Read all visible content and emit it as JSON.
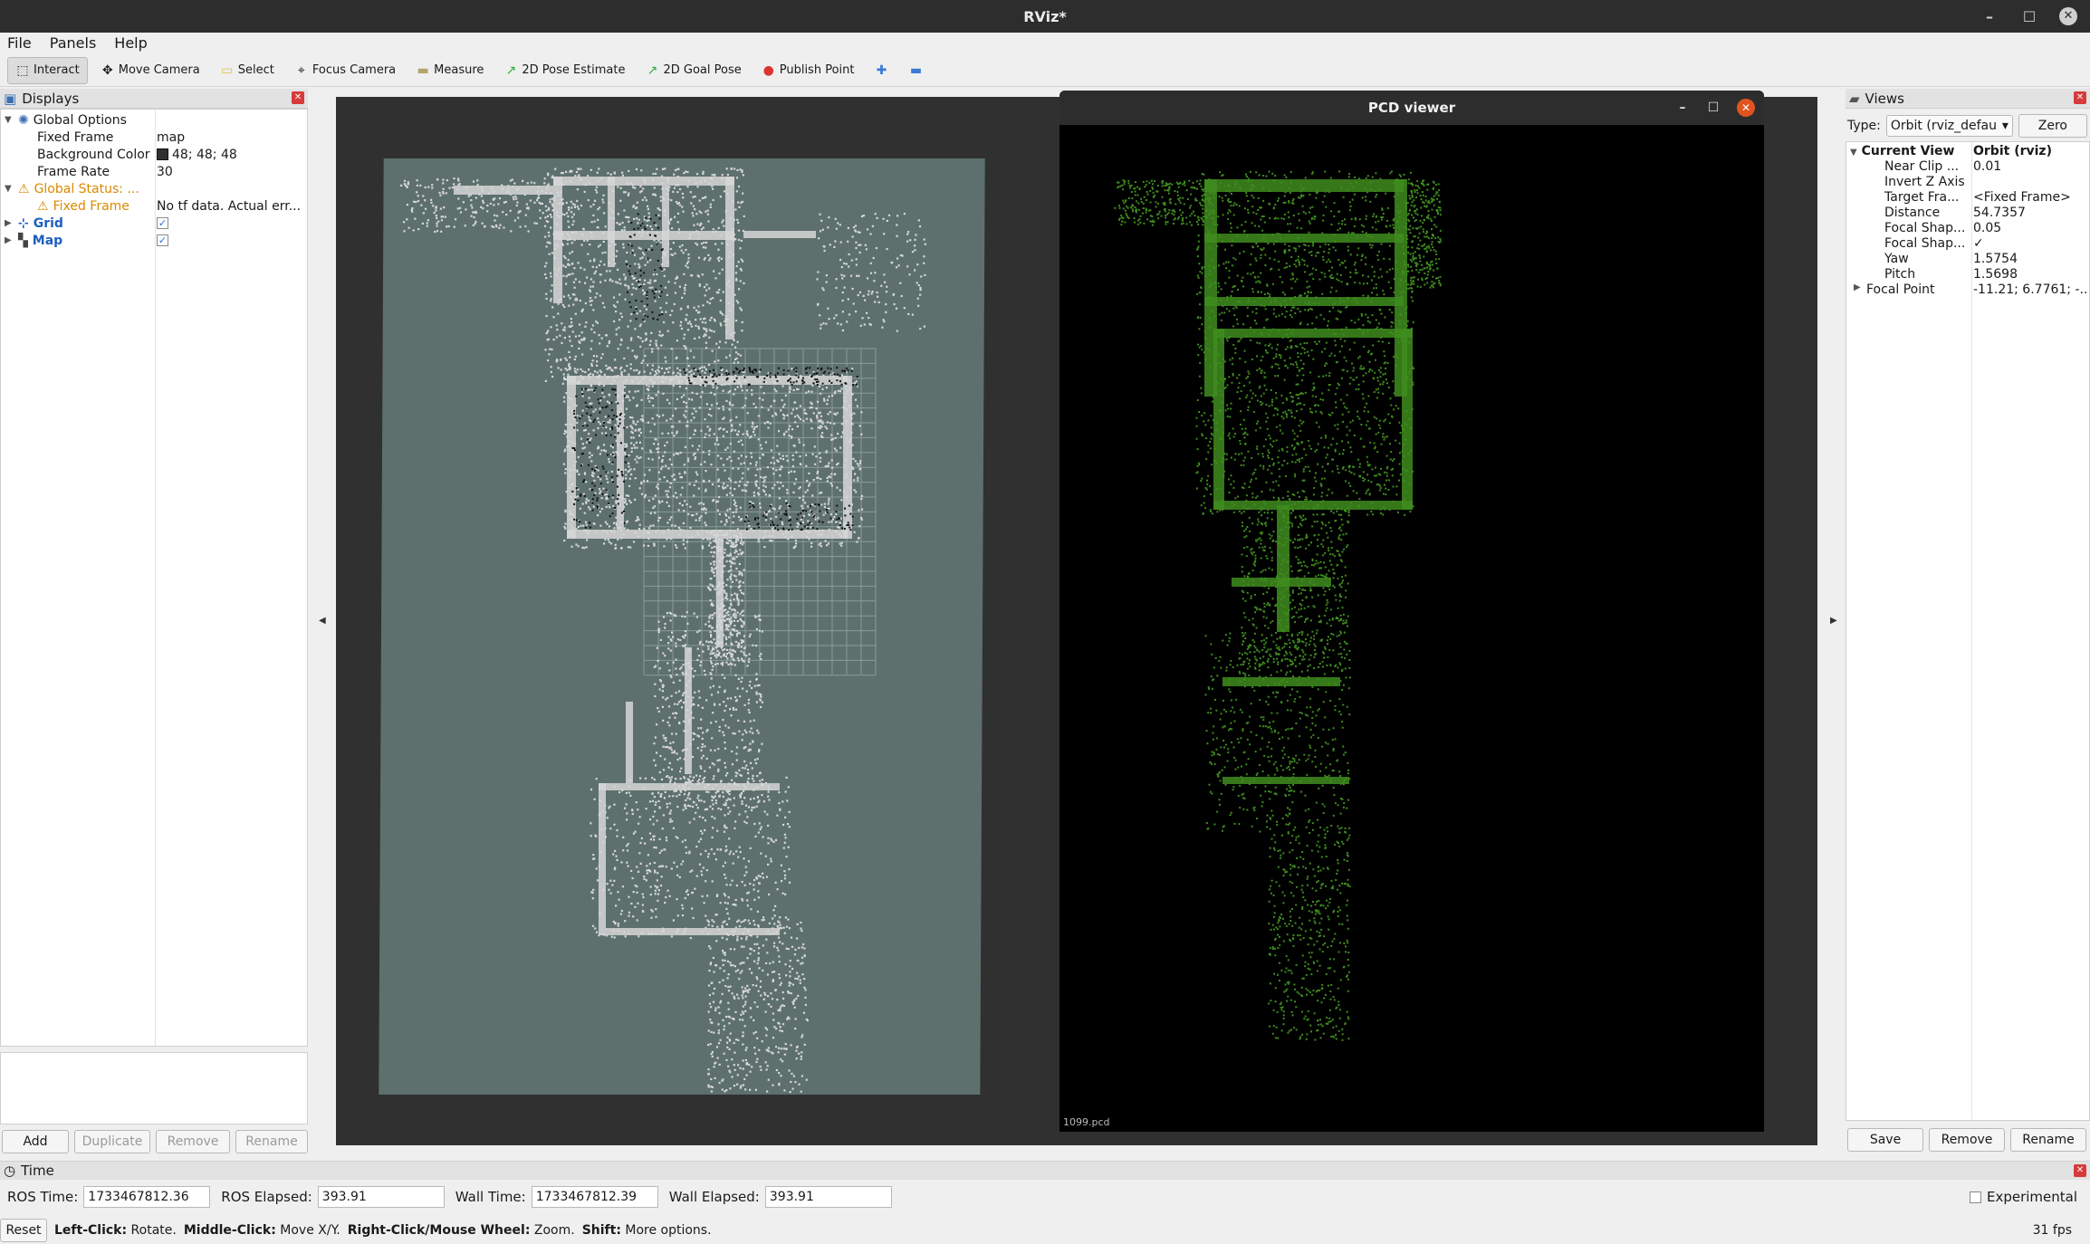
{
  "window": {
    "title": "RViz*"
  },
  "menu": [
    "File",
    "Panels",
    "Help"
  ],
  "toolbar": {
    "tools": [
      {
        "label": "Interact",
        "icon": "interact-icon",
        "glyph": "⬚",
        "active": true
      },
      {
        "label": "Move Camera",
        "icon": "move-camera-icon",
        "glyph": "✥",
        "active": false
      },
      {
        "label": "Select",
        "icon": "select-icon",
        "glyph": "▭",
        "active": false
      },
      {
        "label": "Focus Camera",
        "icon": "focus-camera-icon",
        "glyph": "⌖",
        "active": false
      },
      {
        "label": "Measure",
        "icon": "measure-icon",
        "glyph": "▬",
        "active": false
      },
      {
        "label": "2D Pose Estimate",
        "icon": "pose-estimate-icon",
        "glyph": "↗",
        "active": false
      },
      {
        "label": "2D Goal Pose",
        "icon": "goal-pose-icon",
        "glyph": "↗",
        "active": false
      },
      {
        "label": "Publish Point",
        "icon": "publish-point-icon",
        "glyph": "●",
        "active": false
      }
    ],
    "plus": "✚",
    "minus": "▬"
  },
  "displays": {
    "title": "Displays",
    "global_options": "Global Options",
    "fixed_frame_label": "Fixed Frame",
    "fixed_frame_value": "map",
    "background_label": "Background Color",
    "background_value": "48; 48; 48",
    "frame_rate_label": "Frame Rate",
    "frame_rate_value": "30",
    "global_status": "Global Status: ...",
    "status_fixed_frame": "Fixed Frame",
    "status_fixed_frame_value": "No tf data.  Actual err...",
    "grid": "Grid",
    "map": "Map",
    "buttons": [
      "Add",
      "Duplicate",
      "Remove",
      "Rename"
    ]
  },
  "pcd": {
    "title": "PCD viewer",
    "label": "1099.pcd"
  },
  "views": {
    "title": "Views",
    "type_label": "Type:",
    "type_value": "Orbit (rviz_defau",
    "zero": "Zero",
    "current_view_label": "Current View",
    "current_view_value": "Orbit (rviz)",
    "rows": [
      {
        "k": "Near Clip ...",
        "v": "0.01"
      },
      {
        "k": "Invert Z Axis",
        "v": ""
      },
      {
        "k": "Target Fra...",
        "v": "<Fixed Frame>"
      },
      {
        "k": "Distance",
        "v": "54.7357"
      },
      {
        "k": "Focal Shap...",
        "v": "0.05"
      },
      {
        "k": "Focal Shap...",
        "v": "✓"
      },
      {
        "k": "Yaw",
        "v": "1.5754"
      },
      {
        "k": "Pitch",
        "v": "1.5698"
      },
      {
        "k": "Focal Point",
        "v": "-11.21; 6.7761; -..."
      }
    ],
    "buttons": [
      "Save",
      "Remove",
      "Rename"
    ]
  },
  "time": {
    "title": "Time",
    "ros_time_label": "ROS Time:",
    "ros_time": "1733467812.36",
    "ros_elapsed_label": "ROS Elapsed:",
    "ros_elapsed": "393.91",
    "wall_time_label": "Wall Time:",
    "wall_time": "1733467812.39",
    "wall_elapsed_label": "Wall Elapsed:",
    "wall_elapsed": "393.91",
    "experimental": "Experimental"
  },
  "status": {
    "reset": "Reset",
    "lc": "Left-Click:",
    "lc_t": "Rotate.",
    "mc": "Middle-Click:",
    "mc_t": "Move X/Y.",
    "rc": "Right-Click/Mouse Wheel:",
    "rc_t": "Zoom.",
    "sh": "Shift:",
    "sh_t": "More options.",
    "fps": "31 fps"
  },
  "colors": {
    "viewport": "#303030",
    "map": "#5d706e",
    "points_gray": "#d6d6d6",
    "points_green": "#3f8c1f"
  }
}
